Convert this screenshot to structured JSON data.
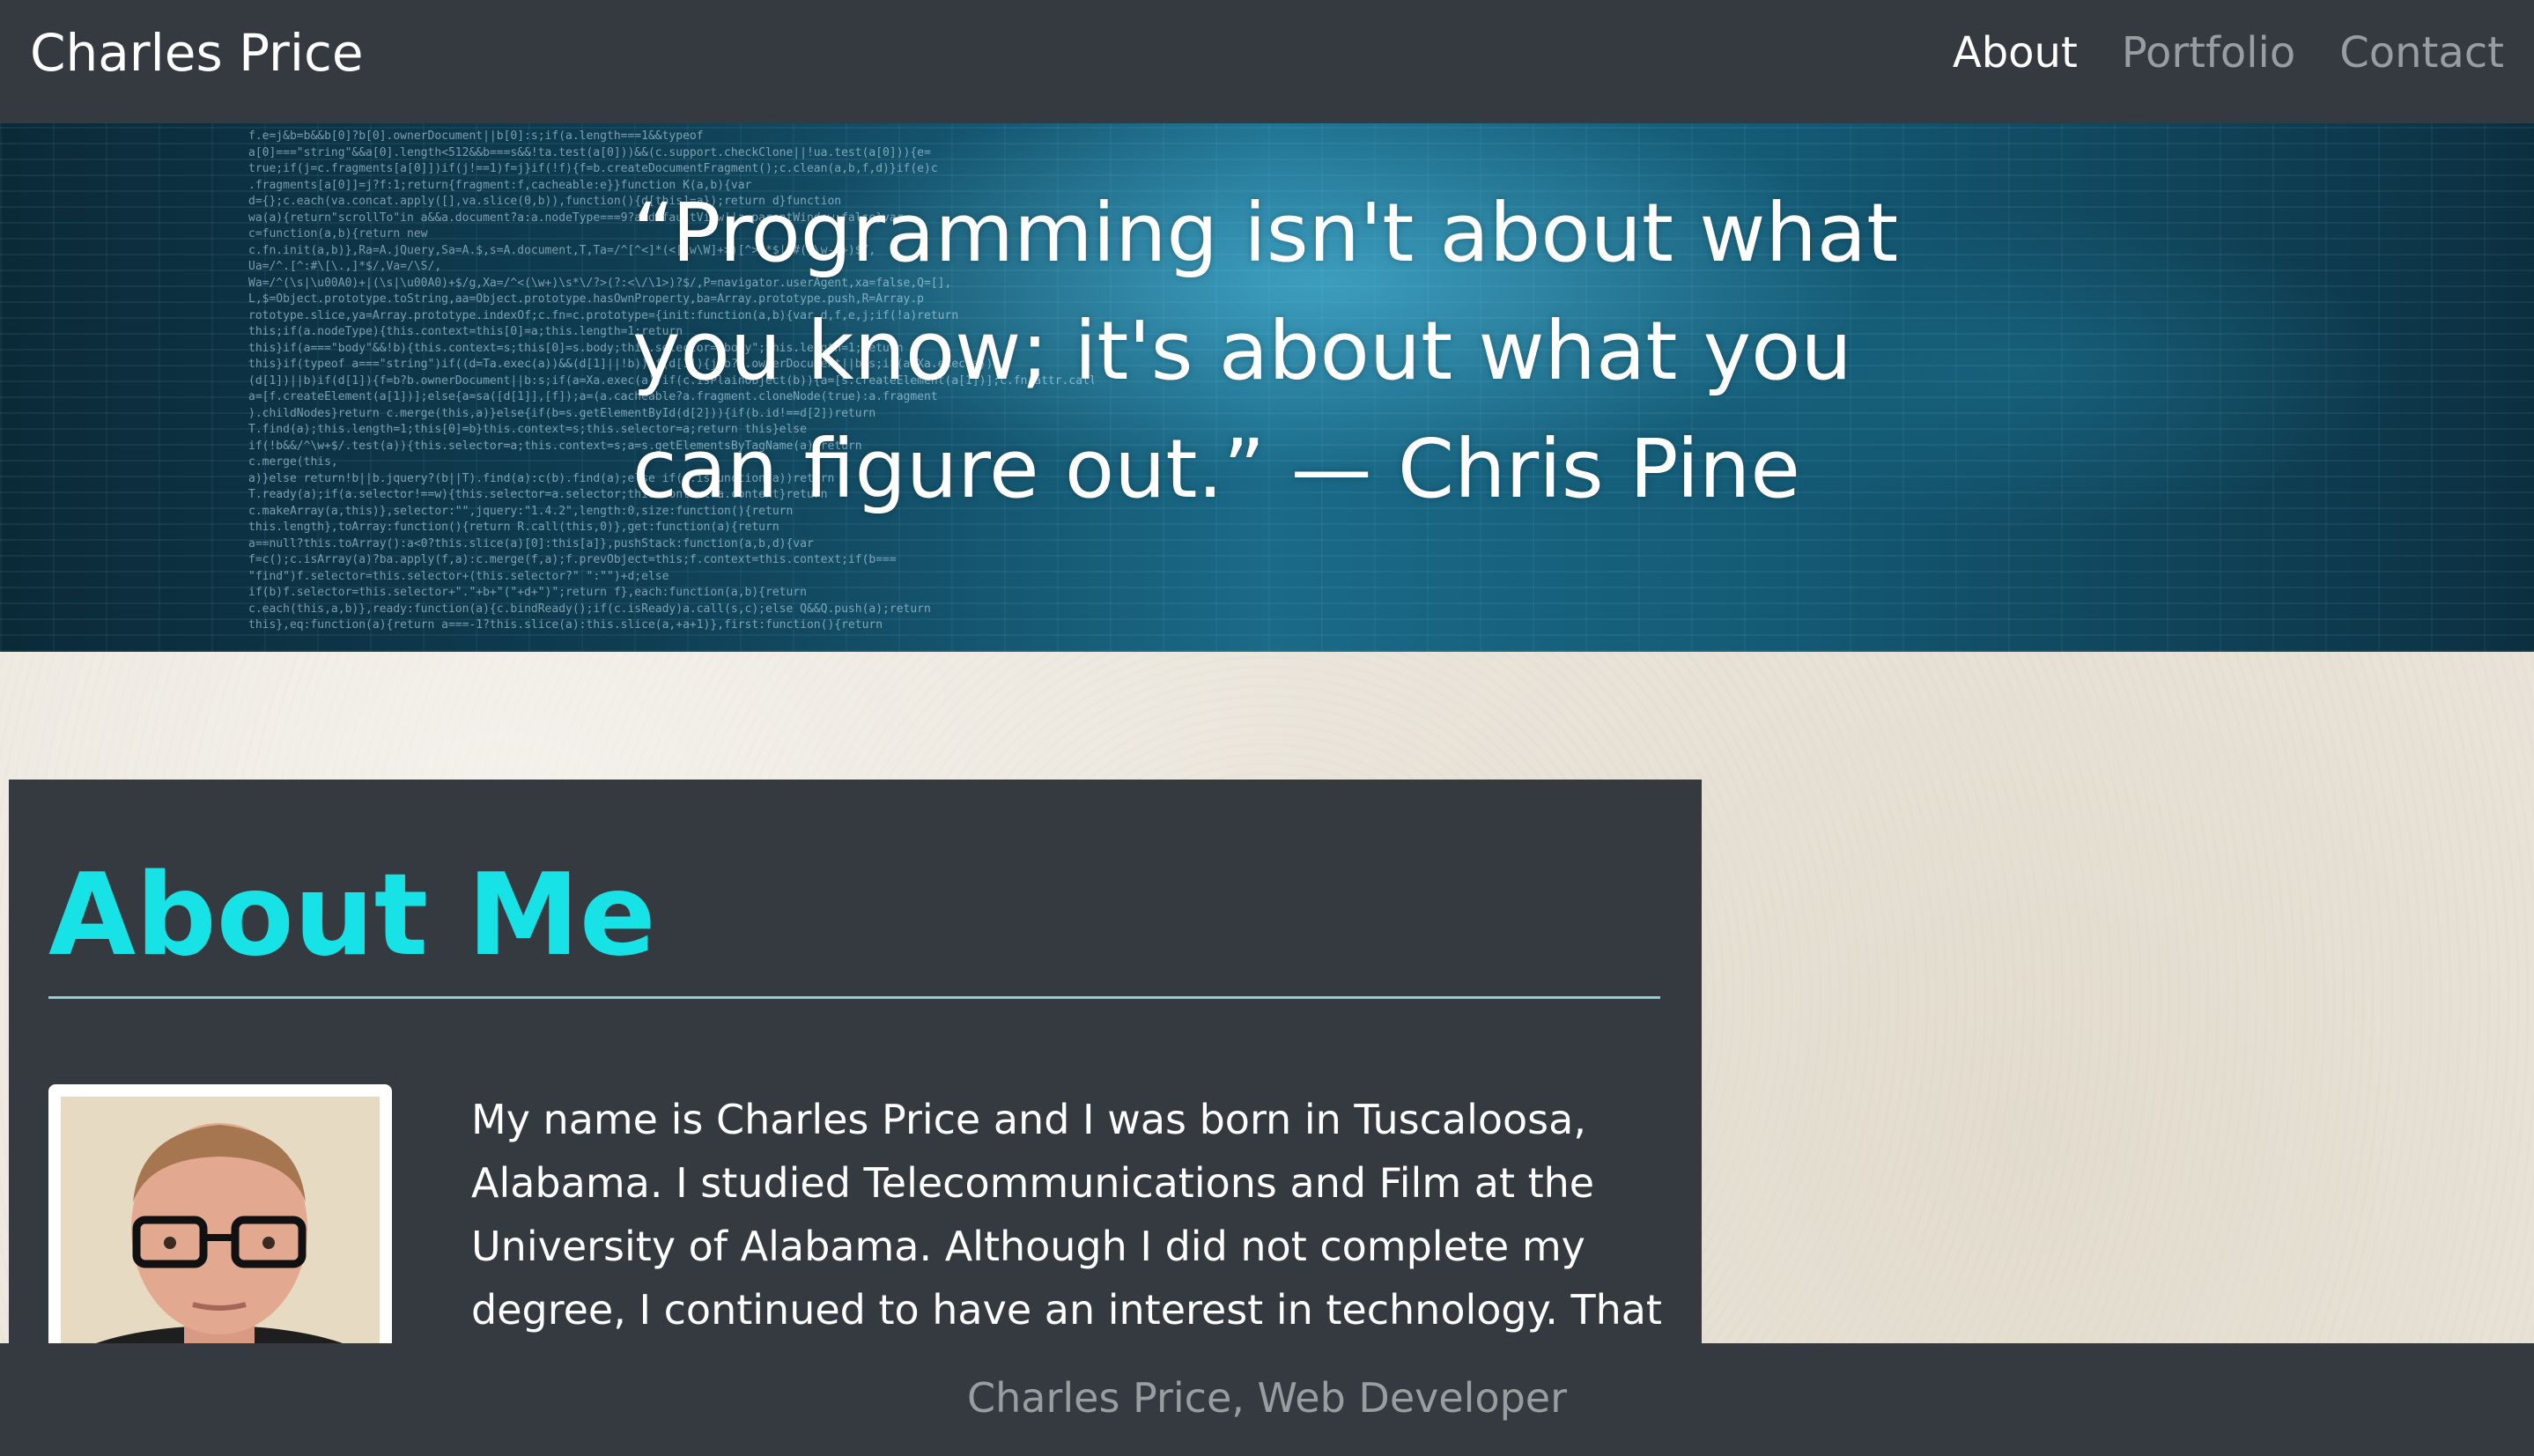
{
  "navbar": {
    "brand": "Charles Price",
    "links": [
      {
        "label": "About",
        "active": true
      },
      {
        "label": "Portfolio",
        "active": false
      },
      {
        "label": "Contact",
        "active": false
      }
    ]
  },
  "hero": {
    "quote": "“Programming isn't about what you know; it's about what you can figure out.” — Chris Pine"
  },
  "about": {
    "heading": "About Me",
    "avatar_alt": "Charles Price",
    "body": "My name is Charles Price and I was born in Tuscaloosa, Alabama. I studied Telecommunications and Film at the University of Alabama. Although I did not complete my degree, I continued to have an interest in technology. That interest led"
  },
  "footer": {
    "text": "Charles Price, Web Developer"
  },
  "colors": {
    "dark": "#343a40",
    "accent": "#17e2e6",
    "rule": "#8ecfd9",
    "paper": "#ebe6dc"
  }
}
